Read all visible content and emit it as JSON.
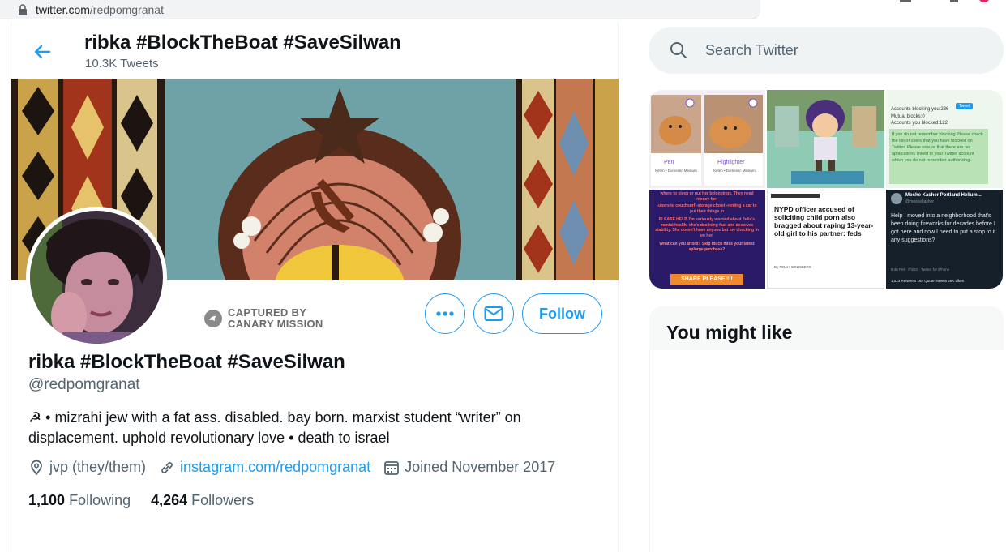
{
  "browser": {
    "url_domain": "twitter.com",
    "url_path": "/redpomgranat"
  },
  "header": {
    "display_name": "ribka #BlockTheBoat #SaveSilwan",
    "tweet_count": "10.3K Tweets"
  },
  "captured_badge": {
    "line1": "CAPTURED BY",
    "line2": "CANARY MISSION"
  },
  "actions": {
    "follow_label": "Follow"
  },
  "profile": {
    "display_name": "ribka #BlockTheBoat #SaveSilwan",
    "handle": "@redpomgranat",
    "bio": "☭ • mizrahi jew with a fat ass. disabled. bay born. marxist student “writer” on displacement. uphold revolutionary love • death to israel",
    "location": "jvp (they/them)",
    "website": "instagram.com/redpomgranat",
    "joined": "Joined November 2017",
    "following_count": "1,100",
    "following_label": "Following",
    "followers_count": "4,264",
    "followers_label": "Followers"
  },
  "search": {
    "placeholder": "Search Twitter"
  },
  "media": {
    "tile1": {
      "card_a": "Pen",
      "card_b": "Highlighter",
      "sub_a": "Kitten • Domestic Medium",
      "sub_b": "Kitten • Domestic Medium"
    },
    "tile3": {
      "lines": [
        "Accounts blocking you:236",
        "Mutual blocks:0",
        "Accounts you blocked:122"
      ],
      "green": "If you do not remember blocking Please check the list of users that you have blocked on Twitter. Please ensure that there are no applications linked to your Twitter account which you do not remember authorizing.",
      "tweet_btn": "Tweet"
    },
    "tile4": {
      "text1": "where to sleep or put her belongings. They need money for:",
      "text2": "-ubers to couchsurf -storage closet -renting a car to put their things in",
      "text3": "PLEASE HELP. I'm seriously worried about Julia's mental health; she's declining fast and deserves stability. She doesn't have anyone but me checking in on her.",
      "text4": "What can you afford? Skip much miss your latest splurge purchase?",
      "cta": "SHARE PLEASE!!!!"
    },
    "tile5": {
      "headline": "NYPD officer accused of soliciting child porn also bragged about raping 13-year-old girl to his partner: feds",
      "byline": "By NOAH GOLDBERG"
    },
    "tile6": {
      "name": "Moshe Kasher Portland Helium...",
      "handle": "@moshekasher",
      "text": "Help I moved into a neighborhood that's been doing fireworks for decades before I got here and now I need to put a stop to it. any suggestions?",
      "time": "6:46 PM · 7/4/21 · Twitter for iPhone",
      "stats": "1,023 Retweets  164 Quote Tweets  28K Likes"
    }
  },
  "sidebar": {
    "might_like_title": "You might like"
  },
  "colors": {
    "accent": "#1d9bf0",
    "text_secondary": "#536471"
  }
}
